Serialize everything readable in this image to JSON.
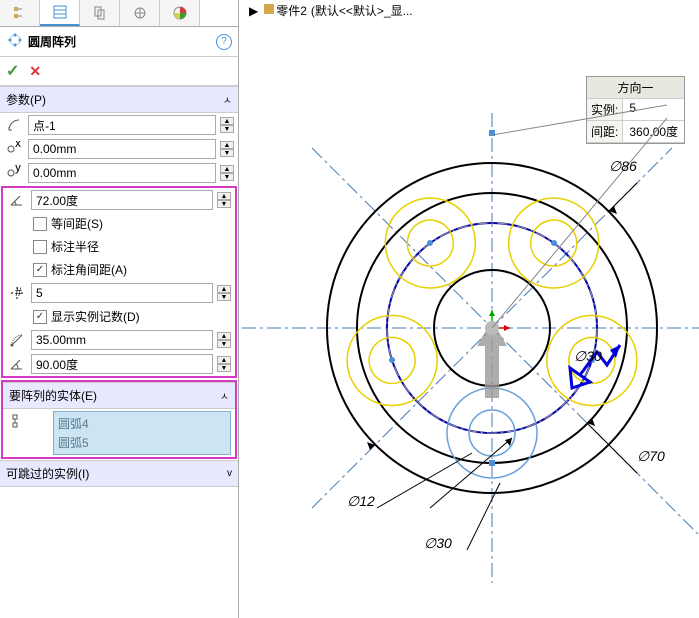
{
  "breadcrumb": {
    "part": "零件2",
    "config": "(默认<<默认>_显..."
  },
  "feature": {
    "title": "圆周阵列"
  },
  "sections": {
    "params": "参数(P)",
    "entities": "要阵列的实体(E)",
    "skip": "可跳过的实例(I)"
  },
  "fields": {
    "point": "点-1",
    "offset1": "0.00mm",
    "offset2": "0.00mm",
    "angle": "72.00度",
    "count": "5",
    "radius": "35.00mm",
    "arc": "90.00度"
  },
  "checks": {
    "equal": "等间距(S)",
    "dimRadius": "标注半径",
    "dimAngle": "标注角间距(A)",
    "showCount": "显示实例记数(D)"
  },
  "entities": [
    "圆弧4",
    "圆弧5"
  ],
  "callout": {
    "header": "方向一",
    "instances_label": "实例:",
    "instances": "5",
    "spacing_label": "间距:",
    "spacing": "360.00度"
  },
  "dims": {
    "d86": "∅86",
    "d70": "∅70",
    "d30a": "∅30",
    "d30b": "∅30",
    "d12": "∅12"
  }
}
